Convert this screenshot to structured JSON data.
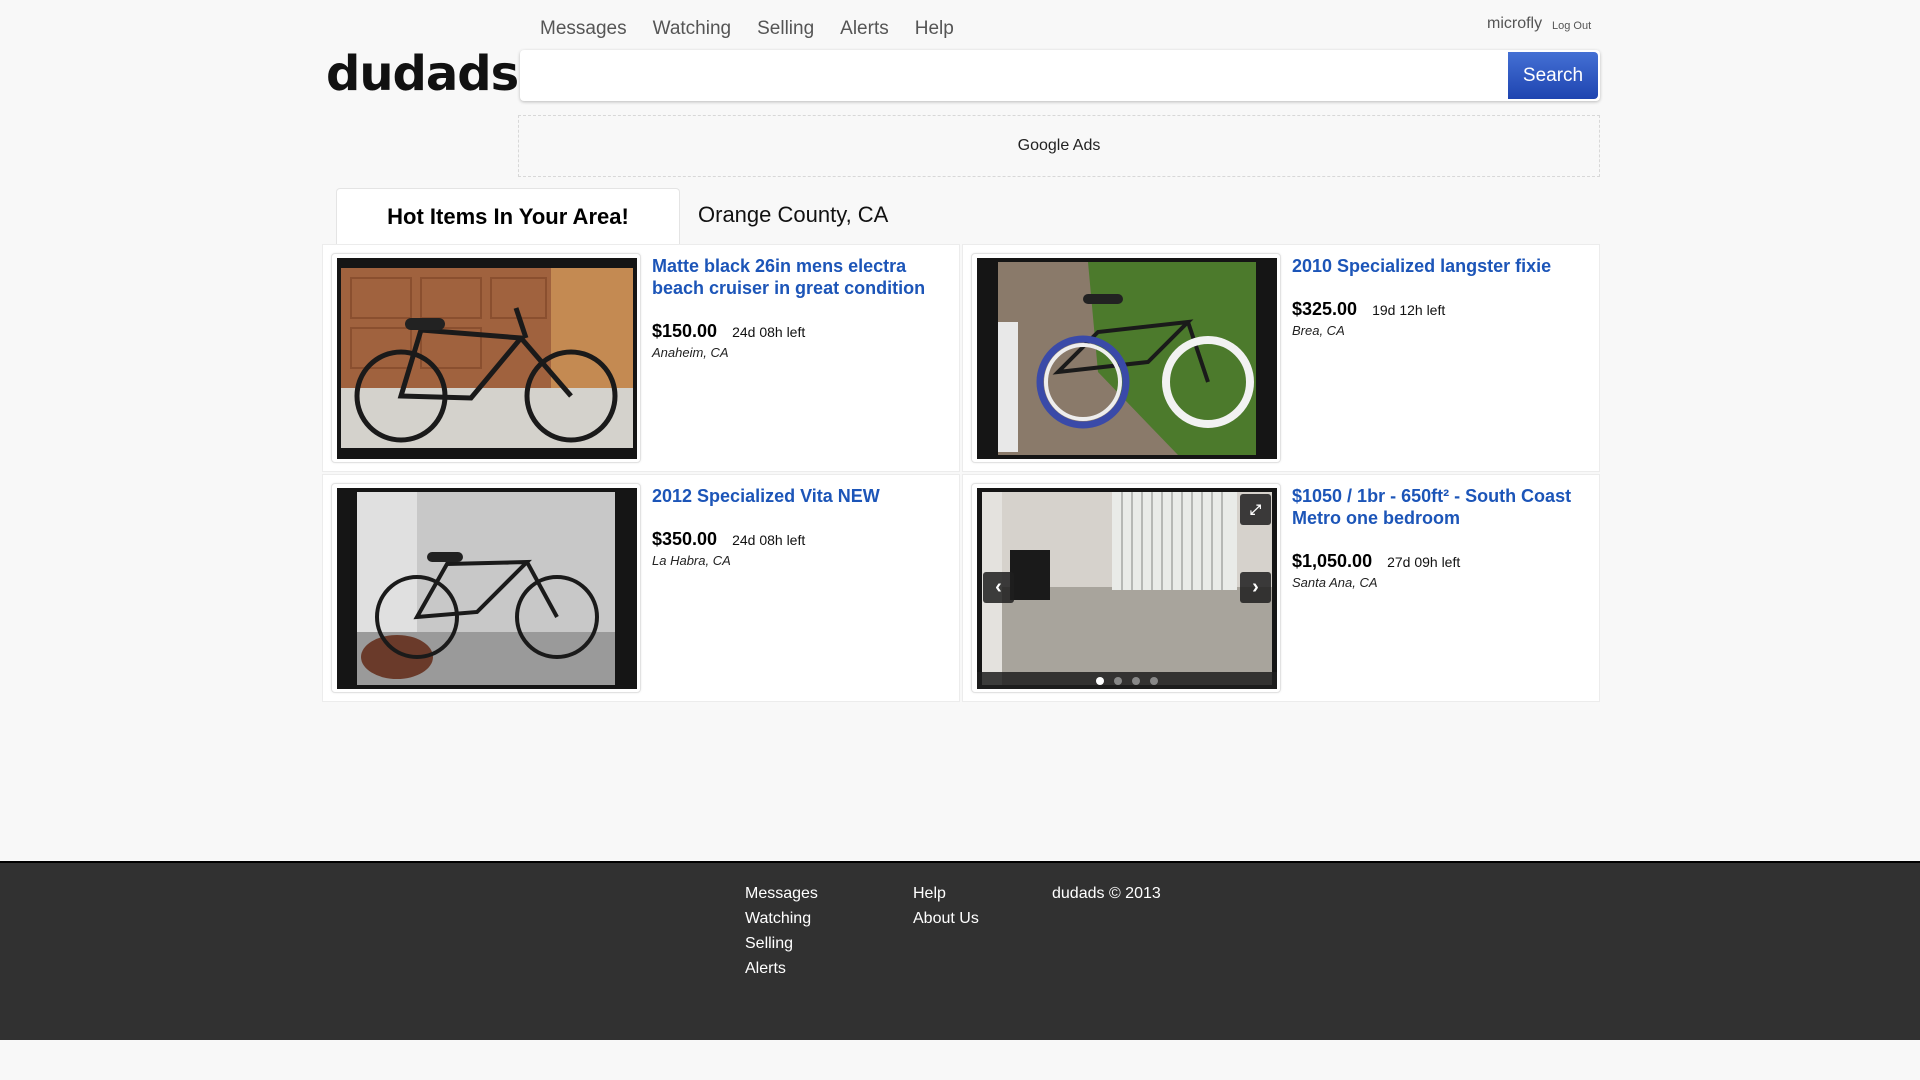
{
  "header": {
    "logo": "dudads",
    "nav": [
      "Messages",
      "Watching",
      "Selling",
      "Alerts",
      "Help"
    ],
    "user": "microfly",
    "logout_label": "Log Out",
    "search": {
      "value": "",
      "placeholder": "",
      "button_label": "Search"
    },
    "ads_label": "Google Ads"
  },
  "tabs": {
    "active_label": "Hot Items In Your Area!",
    "location": "Orange County, CA"
  },
  "listings": [
    {
      "title": "Matte black 26in mens electra beach cruiser in great condition",
      "price": "$150.00",
      "time_left": "24d 08h left",
      "location": "Anaheim, CA"
    },
    {
      "title": "2010 Specialized langster fixie",
      "price": "$325.00",
      "time_left": "19d 12h left",
      "location": "Brea, CA"
    },
    {
      "title": "2012 Specialized Vita NEW",
      "price": "$350.00",
      "time_left": "24d 08h left",
      "location": "La Habra, CA"
    },
    {
      "title": "$1050 / 1br - 650ft² - South Coast Metro one bedroom",
      "price": "$1,050.00",
      "time_left": "27d 09h left",
      "location": "Santa Ana, CA",
      "gallery": {
        "count": 4,
        "active": 1,
        "prev_icon": "‹",
        "next_icon": "›"
      }
    }
  ],
  "footer": {
    "col1": [
      "Messages",
      "Watching",
      "Selling",
      "Alerts"
    ],
    "col2": [
      "Help",
      "About Us"
    ],
    "copyright": "dudads © 2013"
  },
  "colors": {
    "link": "#1c55b8",
    "search_button": "#2a52be",
    "footer_bg": "#313131"
  }
}
